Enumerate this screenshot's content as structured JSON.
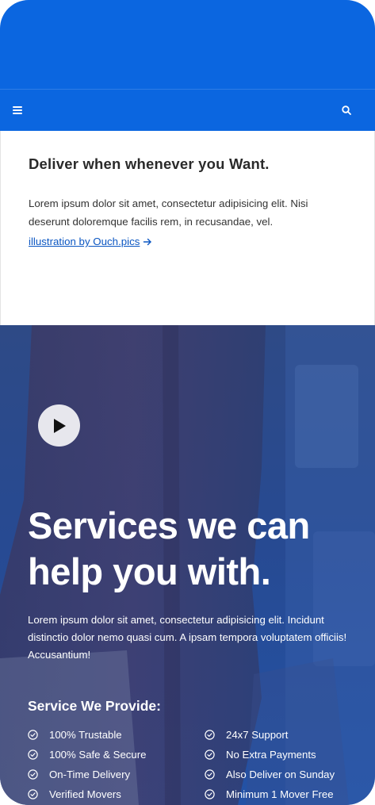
{
  "colors": {
    "brand": "#0b66e0",
    "link": "#0b56c2",
    "overlay": "#274a92"
  },
  "navbar": {
    "menu_icon": "hamburger-menu-icon",
    "search_icon": "search-icon"
  },
  "intro": {
    "title": "Deliver when whenever you Want.",
    "body": "Lorem ipsum dolor sit amet, consectetur adipisicing elit. Nisi deserunt doloremque facilis rem, in recusandae, vel.",
    "link_label": "illustration by Ouch.pics",
    "link_icon": "arrow-right-icon"
  },
  "services": {
    "play_icon": "play-icon",
    "title_line1": "Services we can",
    "title_line2": "help you with.",
    "description": "Lorem ipsum dolor sit amet, consectetur adipisicing elit. Incidunt distinctio dolor nemo quasi cum. A ipsam tempora voluptatem officiis! Accusantium!",
    "subheading": "Service We Provide:",
    "items": [
      "100% Trustable",
      "24x7 Support",
      "100% Safe & Secure",
      "No Extra Payments",
      "On-Time Delivery",
      "Also Deliver on Sunday",
      "Verified Movers",
      "Minimum 1 Mover Free"
    ]
  }
}
